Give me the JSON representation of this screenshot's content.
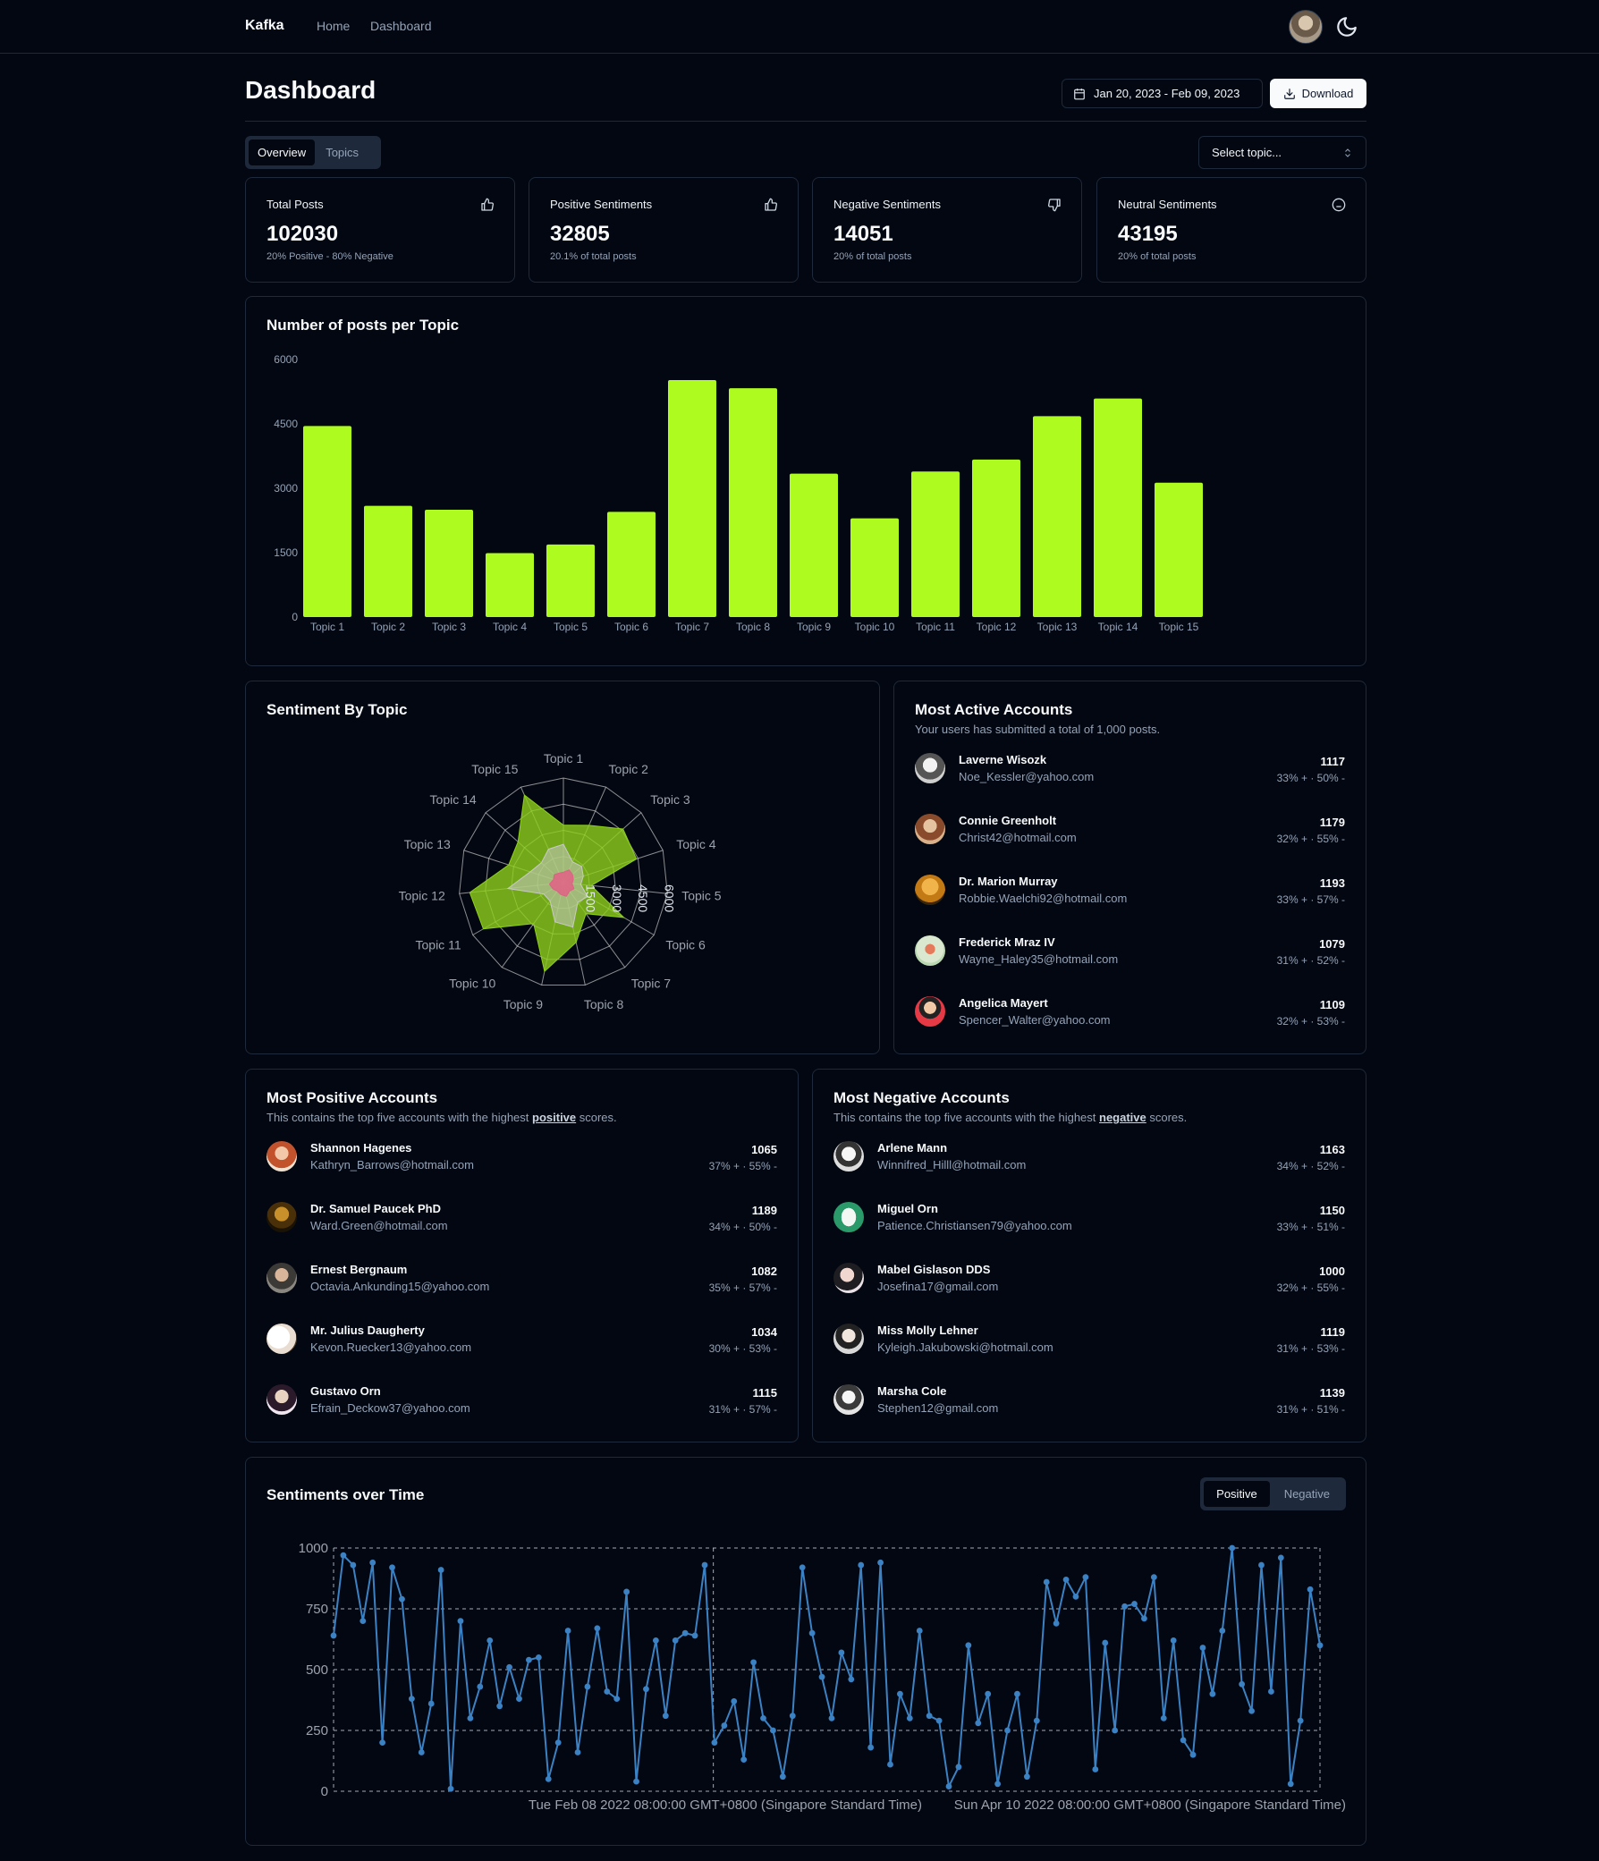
{
  "nav": {
    "brand": "Kafka",
    "links": [
      "Home",
      "Dashboard"
    ]
  },
  "header": {
    "title": "Dashboard",
    "date_range": "Jan 20, 2023 - Feb 09, 2023",
    "download_label": "Download"
  },
  "tabs": [
    "Overview",
    "Topics"
  ],
  "select_placeholder": "Select topic...",
  "stats": [
    {
      "title": "Total Posts",
      "value": "102030",
      "sub": "20% Positive - 80% Negative",
      "icon": "thumbs-up-icon"
    },
    {
      "title": "Positive Sentiments",
      "value": "32805",
      "sub": "20.1% of total posts",
      "icon": "thumbs-up-icon"
    },
    {
      "title": "Negative Sentiments",
      "value": "14051",
      "sub": "20% of total posts",
      "icon": "thumbs-down-icon"
    },
    {
      "title": "Neutral Sentiments",
      "value": "43195",
      "sub": "20% of total posts",
      "icon": "neutral-face-icon"
    }
  ],
  "posts_card": {
    "title": "Number of posts per Topic"
  },
  "sentiment_card": {
    "title": "Sentiment By Topic"
  },
  "active_card": {
    "title": "Most Active Accounts",
    "desc": "Your users has submitted a total of 1,000 posts.",
    "accounts": [
      {
        "name": "Laverne Wisozk",
        "email": "Noe_Kessler@yahoo.com",
        "count": "1117",
        "pct": "33% + · 50% -"
      },
      {
        "name": "Connie Greenholt",
        "email": "Christ42@hotmail.com",
        "count": "1179",
        "pct": "32% + · 55% -"
      },
      {
        "name": "Dr. Marion Murray",
        "email": "Robbie.Waelchi92@hotmail.com",
        "count": "1193",
        "pct": "33% + · 57% -"
      },
      {
        "name": "Frederick Mraz IV",
        "email": "Wayne_Haley35@hotmail.com",
        "count": "1079",
        "pct": "31% + · 52% -"
      },
      {
        "name": "Angelica Mayert",
        "email": "Spencer_Walter@yahoo.com",
        "count": "1109",
        "pct": "32% + · 53% -"
      }
    ]
  },
  "positive_card": {
    "title": "Most Positive Accounts",
    "desc_pre": "This contains the top five accounts with the highest ",
    "desc_em": "positive",
    "desc_post": " scores.",
    "accounts": [
      {
        "name": "Shannon Hagenes",
        "email": "Kathryn_Barrows@hotmail.com",
        "count": "1065",
        "pct": "37% + · 55% -"
      },
      {
        "name": "Dr. Samuel Paucek PhD",
        "email": "Ward.Green@hotmail.com",
        "count": "1189",
        "pct": "34% + · 50% -"
      },
      {
        "name": "Ernest Bergnaum",
        "email": "Octavia.Ankunding15@yahoo.com",
        "count": "1082",
        "pct": "35% + · 57% -"
      },
      {
        "name": "Mr. Julius Daugherty",
        "email": "Kevon.Ruecker13@yahoo.com",
        "count": "1034",
        "pct": "30% + · 53% -"
      },
      {
        "name": "Gustavo Orn",
        "email": "Efrain_Deckow37@yahoo.com",
        "count": "1115",
        "pct": "31% + · 57% -"
      }
    ]
  },
  "negative_card": {
    "title": "Most Negative Accounts",
    "desc_pre": "This contains the top five accounts with the highest ",
    "desc_em": "negative",
    "desc_post": " scores.",
    "accounts": [
      {
        "name": "Arlene Mann",
        "email": "Winnifred_Hilll@hotmail.com",
        "count": "1163",
        "pct": "34% + · 52% -"
      },
      {
        "name": "Miguel Orn",
        "email": "Patience.Christiansen79@yahoo.com",
        "count": "1150",
        "pct": "33% + · 51% -"
      },
      {
        "name": "Mabel Gislason DDS",
        "email": "Josefina17@gmail.com",
        "count": "1000",
        "pct": "32% + · 55% -"
      },
      {
        "name": "Miss Molly Lehner",
        "email": "Kyleigh.Jakubowski@hotmail.com",
        "count": "1119",
        "pct": "31% + · 53% -"
      },
      {
        "name": "Marsha Cole",
        "email": "Stephen12@gmail.com",
        "count": "1139",
        "pct": "31% + · 51% -"
      }
    ]
  },
  "time_card": {
    "title": "Sentiments over Time",
    "toggle": [
      "Positive",
      "Negative"
    ]
  },
  "colors": {
    "accent": "#aefc1f",
    "line": "#3b82c4",
    "bg": "#030711",
    "border": "#1e293b"
  },
  "chart_data": [
    {
      "type": "bar",
      "title": "Number of posts per Topic",
      "categories": [
        "Topic 1",
        "Topic 2",
        "Topic 3",
        "Topic 4",
        "Topic 5",
        "Topic 6",
        "Topic 7",
        "Topic 8",
        "Topic 9",
        "Topic 10",
        "Topic 11",
        "Topic 12",
        "Topic 13",
        "Topic 14",
        "Topic 15"
      ],
      "values": [
        4450,
        2590,
        2500,
        1490,
        1690,
        2450,
        5520,
        5330,
        3340,
        2300,
        3390,
        3670,
        4680,
        5090,
        3130
      ],
      "yticks": [
        "0",
        "1500",
        "3000",
        "4500",
        "6000"
      ],
      "ylim": [
        0,
        6000
      ],
      "grid": false
    },
    {
      "type": "radar",
      "title": "Sentiment By Topic",
      "categories": [
        "Topic 1",
        "Topic 2",
        "Topic 3",
        "Topic 4",
        "Topic 5",
        "Topic 6",
        "Topic 7",
        "Topic 8",
        "Topic 9",
        "Topic 10",
        "Topic 11",
        "Topic 12",
        "Topic 13",
        "Topic 14",
        "Topic 15"
      ],
      "rticks": [
        "1500",
        "3000",
        "4500",
        "6000"
      ],
      "rlim": [
        0,
        6000
      ],
      "series": [
        {
          "values": [
            3300,
            3600,
            4600,
            4400,
            1600,
            4000,
            2200,
            3500,
            5200,
            2900,
            5300,
            5400,
            3300,
            3500,
            5500
          ]
        },
        {
          "values": [
            2200,
            1300,
            1400,
            1200,
            1000,
            1600,
            1400,
            2600,
            2300,
            1300,
            1300,
            3200,
            2000,
            1700,
            2100
          ]
        },
        {
          "values": [
            600,
            800,
            700,
            600,
            500,
            700,
            600,
            800,
            700,
            600,
            700,
            800,
            600,
            700,
            600
          ]
        }
      ]
    },
    {
      "type": "line",
      "title": "Sentiments over Time",
      "yticks": [
        "0",
        "250",
        "500",
        "750",
        "1000"
      ],
      "ylim": [
        0,
        1000
      ],
      "xtick_labels": [
        "Tue Feb 08 2022 08:00:00 GMT+0800 (Singapore Standard Time)",
        "Sun Apr 10 2022 08:00:00 GMT+0800 (Singapore Standard Time)"
      ],
      "values": [
        640,
        970,
        930,
        700,
        940,
        200,
        920,
        790,
        380,
        160,
        360,
        910,
        10,
        700,
        300,
        430,
        620,
        350,
        510,
        380,
        540,
        550,
        50,
        200,
        660,
        160,
        430,
        670,
        410,
        380,
        820,
        40,
        420,
        620,
        310,
        620,
        650,
        640,
        930,
        200,
        270,
        370,
        130,
        530,
        300,
        250,
        60,
        310,
        920,
        650,
        470,
        300,
        570,
        460,
        930,
        180,
        940,
        110,
        400,
        300,
        660,
        310,
        290,
        20,
        100,
        600,
        280,
        400,
        30,
        250,
        400,
        60,
        290,
        860,
        690,
        870,
        800,
        880,
        90,
        610,
        250,
        760,
        770,
        710,
        880,
        300,
        620,
        210,
        150,
        590,
        400,
        660,
        1000,
        440,
        330,
        930,
        410,
        960,
        30,
        290,
        830,
        600
      ]
    }
  ]
}
